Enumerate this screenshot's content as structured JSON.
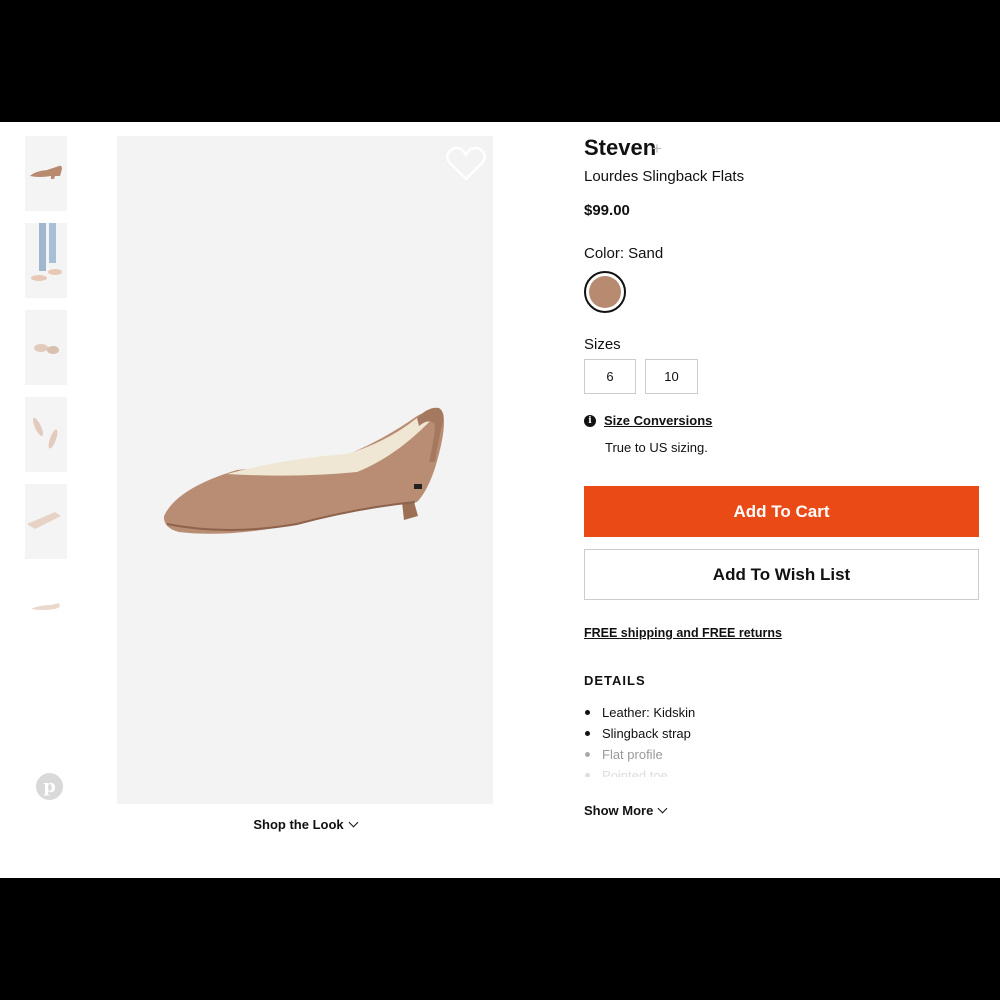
{
  "product": {
    "brand": "Steven",
    "brand_plus": "+",
    "name": "Lourdes Slingback Flats",
    "price": "$99.00"
  },
  "color": {
    "label": "Color: Sand",
    "swatch_color": "#b88b70"
  },
  "sizes": {
    "label": "Sizes",
    "options": [
      "6",
      "10"
    ]
  },
  "size_conversions": {
    "icon": "info-icon",
    "link": "Size Conversions",
    "note": "True to US sizing."
  },
  "actions": {
    "add_to_cart": "Add To Cart",
    "add_to_wish_list": "Add To Wish List",
    "accent_color": "#ea4b16"
  },
  "shipping": "FREE shipping and FREE returns",
  "details": {
    "title": "DETAILS",
    "items": [
      "Leather: Kidskin",
      "Slingback strap",
      "Flat profile",
      "Pointed toe"
    ],
    "show_more": "Show More"
  },
  "gallery": {
    "shop_the_look": "Shop the Look",
    "thumbnail_count": 6,
    "wishlist_icon": "heart-icon",
    "share_icon": "pinterest-icon"
  }
}
